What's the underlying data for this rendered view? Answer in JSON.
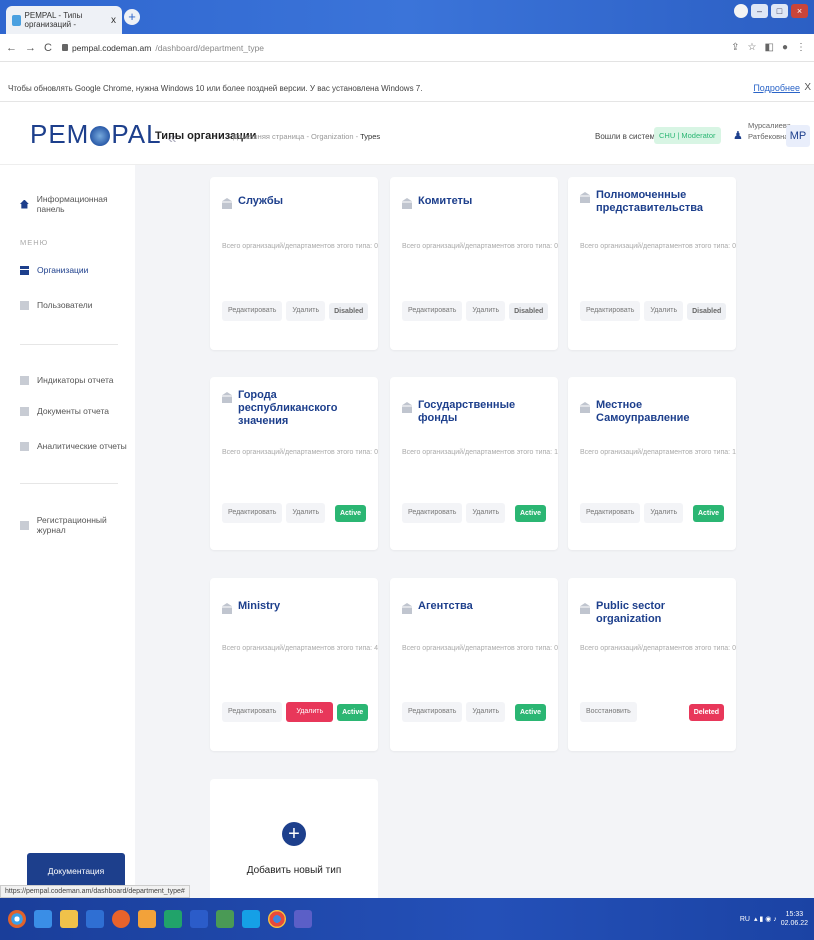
{
  "browser": {
    "tab_title": "PEMPAL - Типы организаций - ",
    "tab_close": "x",
    "url_host": "pempal.codeman.am",
    "url_path": "/dashboard/department_type",
    "info_text": "Чтобы обновлять Google Chrome, нужна Windows 10 или более поздней версии. У вас установлена Windows 7.",
    "info_more": "Подробнее",
    "info_close": "X",
    "status_url": "https://pempal.codeman.am/dashboard/department_type#"
  },
  "header": {
    "logo_left": "PEM",
    "logo_right": "PAL",
    "collapse": "«",
    "page_title": "Типы организации",
    "breadcrumb": {
      "home": "Домашняя страница",
      "sep1": "-",
      "mid": "Organization",
      "sep2": "-",
      "current": "Types"
    },
    "login_label": "Вошли в систему как",
    "role": "CHU | Moderator",
    "user_name_1": "Мурсалиева",
    "user_name_2": "Ратбековна",
    "avatar": "MP"
  },
  "sidebar": {
    "dashboard": "Информационная панель",
    "section_menu": "МЕНЮ",
    "organizations": "Организации",
    "users": "Пользователи",
    "indicators": "Индикаторы отчета",
    "documents": "Документы отчета",
    "analytics": "Аналитические отчеты",
    "log": "Регистрационный журнал",
    "doc_button": "Документация"
  },
  "cards": [
    {
      "title": "Службы",
      "sub": "Всего организаций/департаментов этого типа: 0",
      "edit": "Редактировать",
      "action": "Удалить",
      "status": "Disabled"
    },
    {
      "title": "Комитеты",
      "sub": "Всего организаций/департаментов этого типа: 0",
      "edit": "Редактировать",
      "action": "Удалить",
      "status": "Disabled"
    },
    {
      "title": "Полномоченные представительства",
      "sub": "Всего организаций/департаментов этого типа: 0",
      "edit": "Редактировать",
      "action": "Удалить",
      "status": "Disabled"
    },
    {
      "title": "Города республиканского значения",
      "sub": "Всего организаций/департаментов этого типа: 0",
      "edit": "Редактировать",
      "action": "Удалить",
      "status": "Active"
    },
    {
      "title": "Государственные фонды",
      "sub": "Всего организаций/департаментов этого типа: 1",
      "edit": "Редактировать",
      "action": "Удалить",
      "status": "Active"
    },
    {
      "title": "Местное Самоуправление",
      "sub": "Всего организаций/департаментов этого типа: 1",
      "edit": "Редактировать",
      "action": "Удалить",
      "status": "Active"
    },
    {
      "title": "Ministry",
      "sub": "Всего организаций/департаментов этого типа: 4",
      "edit": "Редактировать",
      "action": "Удалить",
      "status": "Active"
    },
    {
      "title": "Агентства",
      "sub": "Всего организаций/департаментов этого типа: 0",
      "edit": "Редактировать",
      "action": "Удалить",
      "status": "Active"
    },
    {
      "title": "Public sector organization",
      "sub": "Всего организаций/департаментов этого типа: 0",
      "edit": "",
      "action": "Восстановить",
      "status": "Deleted"
    }
  ],
  "add_card": {
    "plus": "+",
    "label": "Добавить новый тип"
  },
  "taskbar": {
    "lang": "RU",
    "time": "15:33",
    "date": "02.06.22"
  }
}
